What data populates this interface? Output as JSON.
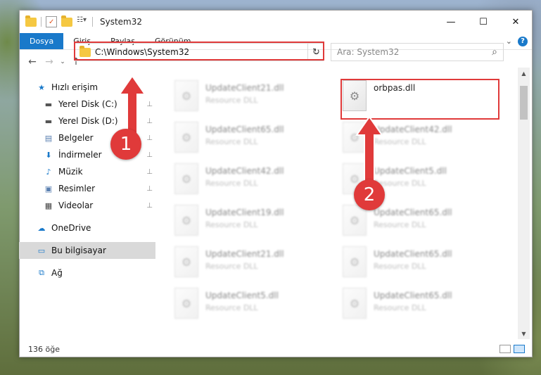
{
  "window": {
    "title": "System32",
    "minimize": "—",
    "maximize": "☐",
    "close": "✕"
  },
  "ribbon": {
    "tabs": [
      "Dosya",
      "Giriş",
      "Paylaş",
      "Görünüm"
    ],
    "active_tab": "Dosya",
    "expand_glyph": "⌄",
    "help_glyph": "?"
  },
  "nav": {
    "back": "←",
    "forward": "→",
    "recent": "⌄",
    "up": "↑"
  },
  "address": {
    "path": "C:\\Windows\\System32",
    "dropdown": "⌄",
    "refresh": "↻"
  },
  "search": {
    "placeholder": "Ara: System32",
    "icon": "⌕"
  },
  "sidebar": {
    "items": [
      {
        "label": "Hızlı erişim",
        "icon": "star-icon",
        "glyph": "★",
        "color": "#1979ca",
        "pinned": false
      },
      {
        "label": "Yerel Disk (C:)",
        "icon": "drive-icon",
        "glyph": "▬",
        "color": "#555555",
        "pinned": true
      },
      {
        "label": "Yerel Disk (D:)",
        "icon": "drive-icon",
        "glyph": "▬",
        "color": "#555555",
        "pinned": true
      },
      {
        "label": "Belgeler",
        "icon": "documents-icon",
        "glyph": "▤",
        "color": "#5a7fb0",
        "pinned": true
      },
      {
        "label": "İndirmeler",
        "icon": "downloads-icon",
        "glyph": "⬇",
        "color": "#1979ca",
        "pinned": true
      },
      {
        "label": "Müzik",
        "icon": "music-icon",
        "glyph": "♪",
        "color": "#1979ca",
        "pinned": true
      },
      {
        "label": "Resimler",
        "icon": "pictures-icon",
        "glyph": "▣",
        "color": "#5a7fb0",
        "pinned": true
      },
      {
        "label": "Videolar",
        "icon": "videos-icon",
        "glyph": "▦",
        "color": "#444444",
        "pinned": true
      },
      {
        "label": "OneDrive",
        "icon": "onedrive-icon",
        "glyph": "☁",
        "color": "#1979ca",
        "pinned": false
      },
      {
        "label": "Bu bilgisayar",
        "icon": "computer-icon",
        "glyph": "▭",
        "color": "#1979ca",
        "pinned": false,
        "selected": true
      },
      {
        "label": "Ağ",
        "icon": "network-icon",
        "glyph": "⧉",
        "color": "#1979ca",
        "pinned": false
      }
    ],
    "pin_glyph": "📌"
  },
  "files": {
    "left": [
      {
        "name": "UpdateClient21.dll",
        "type": "Resource DLL"
      },
      {
        "name": "UpdateClient65.dll",
        "type": "Resource DLL"
      },
      {
        "name": "UpdateClient42.dll",
        "type": "Resource DLL"
      },
      {
        "name": "UpdateClient19.dll",
        "type": "Resource DLL"
      },
      {
        "name": "UpdateClient21.dll",
        "type": "Resource DLL"
      },
      {
        "name": "UpdateClient5.dll",
        "type": "Resource DLL"
      }
    ],
    "right": [
      {
        "name": "orbpas.dll",
        "type": "",
        "highlighted": true
      },
      {
        "name": "UpdateClient42.dll",
        "type": "Resource DLL"
      },
      {
        "name": "UpdateClient5.dll",
        "type": "Resource DLL"
      },
      {
        "name": "UpdateClient65.dll",
        "type": "Resource DLL"
      },
      {
        "name": "UpdateClient65.dll",
        "type": "Resource DLL"
      },
      {
        "name": "UpdateClient65.dll",
        "type": "Resource DLL"
      }
    ],
    "file_icon": "gears-icon"
  },
  "status": {
    "count": "136 öğe"
  },
  "annotations": {
    "step1": "1",
    "step2": "2",
    "color": "#e03a3a"
  }
}
